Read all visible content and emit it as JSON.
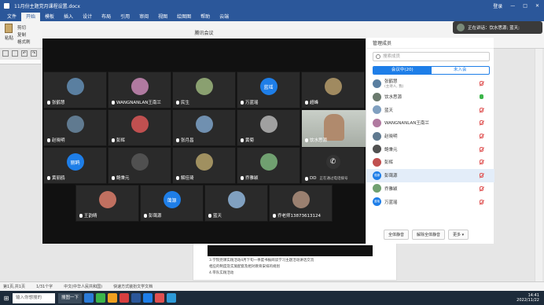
{
  "window": {
    "doc_title": "11月份主题党月课程设置.docx",
    "right_items": [
      "登录",
      "—",
      "□",
      "✕"
    ]
  },
  "menu": {
    "tabs": [
      "文件",
      "开始",
      "模板",
      "插入",
      "设计",
      "布局",
      "引用",
      "审阅",
      "视图",
      "绘图图",
      "帮助",
      "云端"
    ],
    "active_index": 1
  },
  "ribbon": {
    "paste": "粘贴",
    "cut": "剪切",
    "copy": "复制",
    "format_painter": "格式刷"
  },
  "meeting": {
    "title": "腾讯会议",
    "tiles": [
      {
        "name": "张鹤慧",
        "kind": "avatar",
        "label": ""
      },
      {
        "name": "WANGNANLAN王南兰",
        "kind": "avatar",
        "label": ""
      },
      {
        "name": "民生",
        "kind": "avatar",
        "label": ""
      },
      {
        "name": "万蓝瑶",
        "kind": "text",
        "label": "蓝瑶"
      },
      {
        "name": "超峰",
        "kind": "avatar",
        "label": ""
      },
      {
        "name": "赵晓明",
        "kind": "avatar",
        "label": ""
      },
      {
        "name": "彭辉",
        "kind": "avatar",
        "label": ""
      },
      {
        "name": "张月昌",
        "kind": "avatar",
        "label": ""
      },
      {
        "name": "黄菊",
        "kind": "avatar",
        "label": ""
      },
      {
        "name": "饮水思源",
        "kind": "video",
        "label": ""
      },
      {
        "name": "黄丽鸥",
        "kind": "text",
        "label": "丽鸥"
      },
      {
        "name": "鲍秉元",
        "kind": "avatar",
        "label": ""
      },
      {
        "name": "解佳琦",
        "kind": "avatar",
        "label": ""
      },
      {
        "name": "乔雅颖",
        "kind": "avatar",
        "label": ""
      },
      {
        "name": "DD",
        "kind": "phone",
        "label": "正在通过电话拨号"
      },
      {
        "name": "王韵晴",
        "kind": "avatar",
        "label": ""
      },
      {
        "name": "彭蔼源",
        "kind": "text",
        "label": "蔼源"
      },
      {
        "name": "蓝天",
        "kind": "avatar",
        "label": ""
      },
      {
        "name": "乔老师13873613124",
        "kind": "avatar",
        "label": ""
      }
    ]
  },
  "panel": {
    "header": "管理成员",
    "search_placeholder": "搜索成员",
    "tabs": [
      "会议中(20)",
      "未入会"
    ],
    "active_tab": 0,
    "members": [
      {
        "name": "张鹤慧",
        "sub": "(主持人, 我)",
        "mic": "off",
        "avatar": "",
        "selected": false
      },
      {
        "name": "饮水思源",
        "sub": "",
        "mic": "on",
        "avatar": "",
        "selected": false
      },
      {
        "name": "蓝天",
        "sub": "",
        "mic": "off",
        "avatar": "",
        "selected": false
      },
      {
        "name": "WANGNANLAN王南兰",
        "sub": "",
        "mic": "off",
        "avatar": "",
        "selected": false
      },
      {
        "name": "赵晓明",
        "sub": "",
        "mic": "off",
        "avatar": "",
        "selected": false
      },
      {
        "name": "鲍秉元",
        "sub": "",
        "mic": "off",
        "avatar": "",
        "selected": false
      },
      {
        "name": "彭辉",
        "sub": "",
        "mic": "off",
        "avatar": "",
        "selected": false
      },
      {
        "name": "彭蔼源",
        "sub": "",
        "mic": "off",
        "avatar": "蔼源",
        "selected": true
      },
      {
        "name": "乔雅颖",
        "sub": "",
        "mic": "off",
        "avatar": "",
        "selected": false
      },
      {
        "name": "万蓝瑶",
        "sub": "",
        "mic": "off",
        "avatar": "蓝瑶",
        "selected": false
      }
    ],
    "footer": [
      "全体静音",
      "解除全体静音",
      "更多 ▾"
    ]
  },
  "popup": {
    "text": "正在讲话：饮水思源; 蓝天;"
  },
  "document": {
    "lines": [
      "3.学院党课实践活动4月下旬一季度书报阅读学习主题活动讲话交流",
      "相应的制度及实施配套及相对教育安排的规划",
      "4.带队实践活动"
    ]
  },
  "status": {
    "items": [
      "第1页,共1页",
      "1/31个字",
      "中文(中华人民共和国)",
      "快速方式装扮文学文档"
    ]
  },
  "taskbar": {
    "search": "输入你想搜的",
    "buttons": [
      "搜图一下"
    ],
    "time": "14:41",
    "date": "2022/11/22",
    "colors": [
      "#2b7bd8",
      "#3bb54a",
      "#f0a020",
      "#d84040",
      "#2b579a",
      "#1e7ee8",
      "#e05050",
      "#2d9ad8"
    ]
  }
}
